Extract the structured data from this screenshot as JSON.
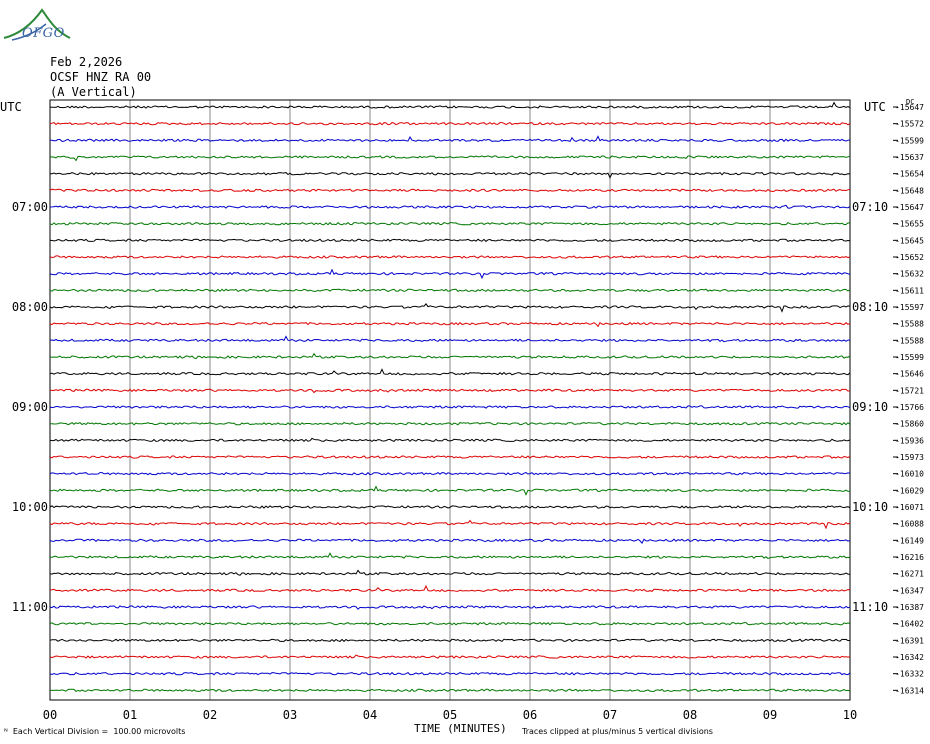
{
  "header": {
    "logo_text": "OFGO",
    "date": "Feb 2,2026",
    "station": "OCSF HNZ RA 00",
    "component": "(A Vertical)"
  },
  "chart_data": {
    "type": "line",
    "left_timezone_label": "UTC",
    "right_timezone_label": "UTC",
    "right_top_marker": "DC",
    "x_ticks": [
      "00",
      "01",
      "02",
      "03",
      "04",
      "05",
      "06",
      "07",
      "08",
      "09",
      "10"
    ],
    "xlabel": "TIME (MINUTES)",
    "xlim": [
      0,
      10
    ],
    "left_hour_labels": [
      "07:00",
      "08:00",
      "09:00",
      "10:00",
      "11:00"
    ],
    "right_hour_labels": [
      "07:10",
      "08:10",
      "09:10",
      "10:10",
      "11:10"
    ],
    "trace_colors": [
      "#000000",
      "#dd0000",
      "#0000cc",
      "#007700"
    ],
    "trace_dc_offsets": [
      "-15647",
      "-15572",
      "-15599",
      "-15637",
      "-15654",
      "-15648",
      "-15647",
      "-15655",
      "-15645",
      "-15652",
      "-15632",
      "-15611",
      "-15597",
      "-15588",
      "-15588",
      "-15599",
      "-15646",
      "-15721",
      "-15766",
      "-15860",
      "-15936",
      "-15973",
      "-16010",
      "-16029",
      "-16071",
      "-16088",
      "-16149",
      "-16216",
      "-16271",
      "-16347",
      "-16387",
      "-16402",
      "-16391",
      "-16342",
      "-16332",
      "-16314"
    ],
    "footer_scale_note": "Each Vertical Division =  100.00 microvolts",
    "footer_clip_note": "Traces clipped at plus/minus 5 vertical divisions",
    "grid": true
  }
}
